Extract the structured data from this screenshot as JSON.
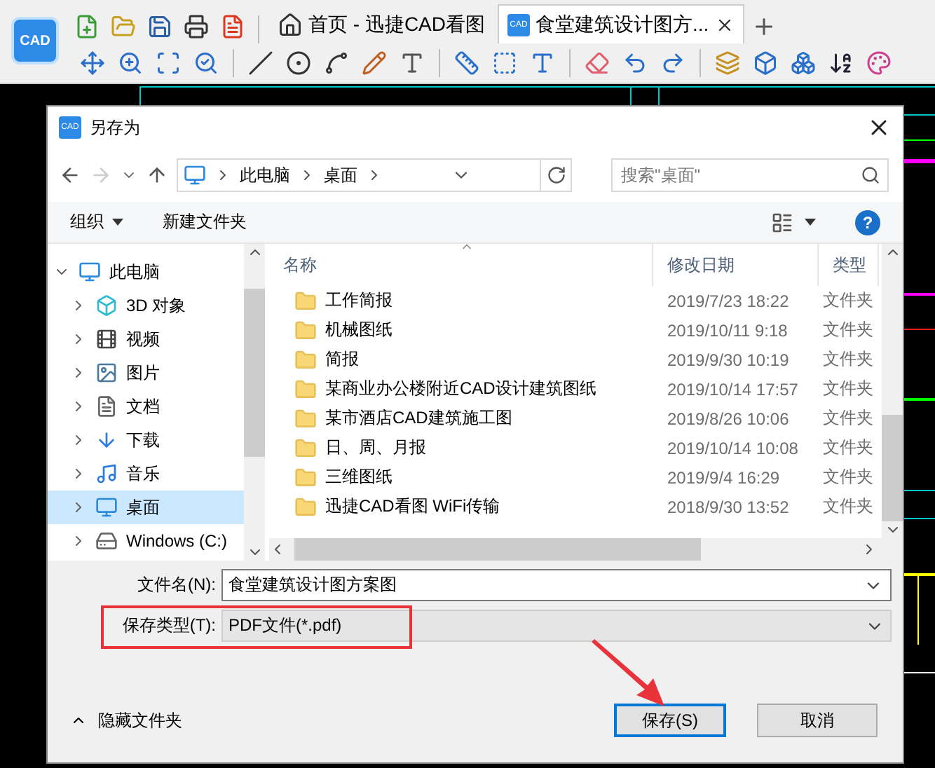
{
  "app": {
    "logo": "CAD",
    "tabs": [
      {
        "label": "首页 - 迅捷CAD看图",
        "selected": false,
        "closable": false
      },
      {
        "label": "食堂建筑设计图方...",
        "icon_text": "CAD",
        "selected": true,
        "closable": true
      }
    ]
  },
  "dialog": {
    "icon_text": "CAD",
    "title": "另存为",
    "nav": {
      "back_disabled": false,
      "forward_disabled": true
    },
    "breadcrumb": [
      "此电脑",
      "桌面"
    ],
    "search": {
      "placeholder": "搜索\"桌面\""
    },
    "commands": [
      {
        "label": "组织",
        "dropdown": true
      },
      {
        "label": "新建文件夹",
        "dropdown": false
      }
    ],
    "help": "?",
    "tree": [
      {
        "label": "此电脑",
        "expanded": true,
        "selected": false,
        "children": [
          {
            "label": "3D 对象",
            "expanded": false,
            "selected": false
          },
          {
            "label": "视频",
            "expanded": false,
            "selected": false
          },
          {
            "label": "图片",
            "expanded": false,
            "selected": false
          },
          {
            "label": "文档",
            "expanded": false,
            "selected": false
          },
          {
            "label": "下载",
            "expanded": false,
            "selected": false
          },
          {
            "label": "音乐",
            "expanded": false,
            "selected": false
          },
          {
            "label": "桌面",
            "expanded": false,
            "selected": true
          },
          {
            "label": "Windows (C:)",
            "expanded": false,
            "selected": false
          }
        ]
      }
    ],
    "columns": [
      "名称",
      "修改日期",
      "类型"
    ],
    "files": [
      {
        "name": "工作简报",
        "modified": "2019/7/23 18:22",
        "type": "文件夹"
      },
      {
        "name": "机械图纸",
        "modified": "2019/10/11 9:18",
        "type": "文件夹"
      },
      {
        "name": "简报",
        "modified": "2019/9/30 10:19",
        "type": "文件夹"
      },
      {
        "name": "某商业办公楼附近CAD设计建筑图纸",
        "modified": "2019/10/14 17:57",
        "type": "文件夹"
      },
      {
        "name": "某市酒店CAD建筑施工图",
        "modified": "2019/8/26 10:06",
        "type": "文件夹"
      },
      {
        "name": "日、周、月报",
        "modified": "2019/10/14 10:08",
        "type": "文件夹"
      },
      {
        "name": "三维图纸",
        "modified": "2019/9/4 16:29",
        "type": "文件夹"
      },
      {
        "name": "迅捷CAD看图 WiFi传输",
        "modified": "2018/9/30 13:52",
        "type": "文件夹"
      }
    ],
    "filename": {
      "label": "文件名(N):",
      "value": "食堂建筑设计图方案图"
    },
    "filetype": {
      "label": "保存类型(T):",
      "value": "PDF文件(*.pdf)"
    },
    "hide_folders": "隐藏文件夹",
    "buttons": [
      {
        "label": "保存(S)",
        "default": true
      },
      {
        "label": "取消",
        "default": false
      }
    ]
  }
}
